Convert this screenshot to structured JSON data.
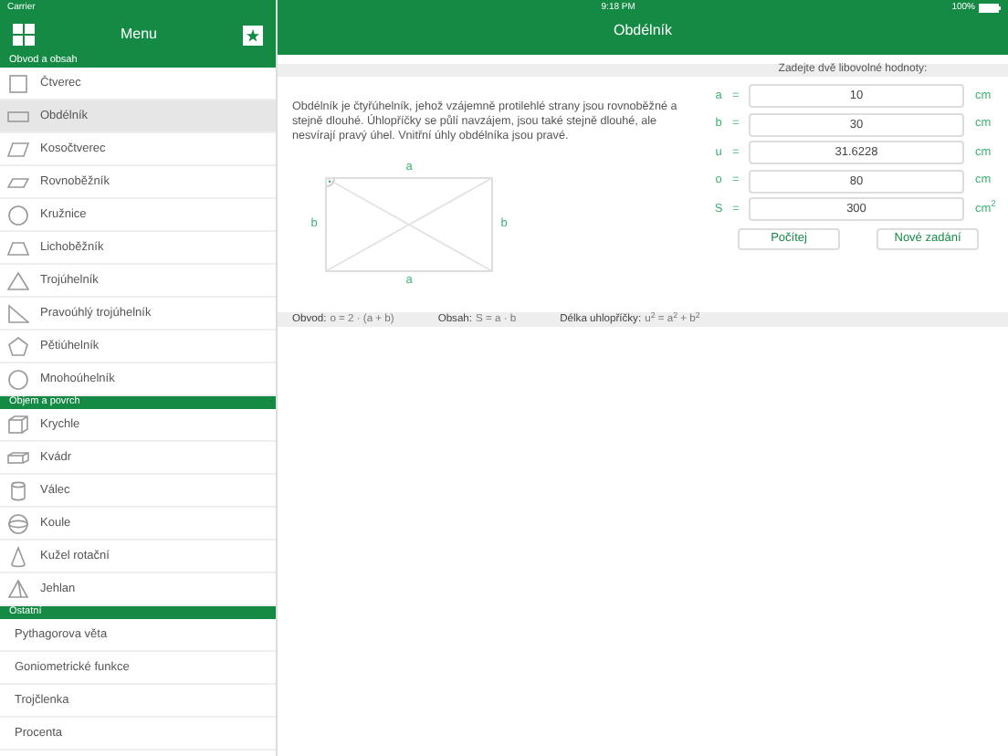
{
  "status_bar": {
    "carrier": "Carrier",
    "time": "9:18 PM",
    "battery": "100%"
  },
  "sidebar": {
    "title": "Menu",
    "sections": [
      {
        "title": "Obvod a obsah",
        "items": [
          {
            "label": "Čtverec",
            "selected": false
          },
          {
            "label": "Obdélník",
            "selected": true
          },
          {
            "label": "Kosočtverec",
            "selected": false
          },
          {
            "label": "Rovnoběžník",
            "selected": false
          },
          {
            "label": "Kružnice",
            "selected": false
          },
          {
            "label": "Lichoběžník",
            "selected": false
          },
          {
            "label": "Trojúhelník",
            "selected": false
          },
          {
            "label": "Pravoúhlý trojúhelník",
            "selected": false
          },
          {
            "label": "Pětiúhelník",
            "selected": false
          },
          {
            "label": "Mnohoúhelník",
            "selected": false
          }
        ]
      },
      {
        "title": "Objem a povrch",
        "items": [
          {
            "label": "Krychle",
            "selected": false
          },
          {
            "label": "Kvádr",
            "selected": false
          },
          {
            "label": "Válec",
            "selected": false
          },
          {
            "label": "Koule",
            "selected": false
          },
          {
            "label": "Kužel rotační",
            "selected": false
          },
          {
            "label": "Jehlan",
            "selected": false
          }
        ]
      },
      {
        "title": "Ostatní",
        "items": [
          {
            "label": "Pythagorova věta",
            "selected": false
          },
          {
            "label": "Goniometrické funkce",
            "selected": false
          },
          {
            "label": "Trojčlenka",
            "selected": false
          },
          {
            "label": "Procenta",
            "selected": false
          }
        ]
      }
    ]
  },
  "main": {
    "title": "Obdélník",
    "prompt": "Zadejte dvě libovolné hodnoty:",
    "description": "Obdélník je čtyřúhelník, jehož vzájemně protilehlé strany jsou rovnoběžné a stejně dlouhé. Úhlopříčky se půlí navzájem, jsou také stejně dlouhé, ale nesvírají pravý úhel. Vnitřní úhly obdélníka jsou pravé.",
    "diagram_labels": {
      "top": "a",
      "left": "b",
      "right": "b",
      "bottom": "a"
    },
    "fields": [
      {
        "label": "a",
        "equals": "=",
        "value": "10",
        "unit": "cm"
      },
      {
        "label": "b",
        "equals": "=",
        "value": "30",
        "unit": "cm"
      },
      {
        "label": "u",
        "equals": "=",
        "value": "31.6228",
        "unit": "cm"
      },
      {
        "label": "o",
        "equals": "=",
        "value": "80",
        "unit": "cm"
      },
      {
        "label": "S",
        "equals": "=",
        "value": "300",
        "unit": "cm$^{2}$"
      }
    ],
    "buttons": [
      "Počítej",
      "Nové zadání"
    ],
    "formulas": [
      {
        "label": "Obvod:",
        "value": "o = 2 · (a + b)"
      },
      {
        "label": "Obsah:",
        "value": "S = a · b"
      },
      {
        "label": "Délka uhlopříčky:",
        "value": "u$^{2}$ = a$^{2}$ + b$^{2}$"
      }
    ]
  }
}
